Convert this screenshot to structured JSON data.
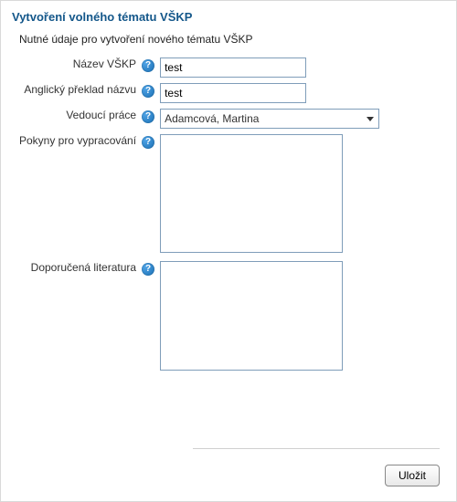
{
  "title": "Vytvoření volného tématu VŠKP",
  "subtitle": "Nutné údaje pro vytvoření nového tématu VŠKP",
  "labels": {
    "name": "Název VŠKP",
    "name_en": "Anglický překlad názvu",
    "supervisor": "Vedoucí práce",
    "instructions": "Pokyny pro vypracování",
    "literature": "Doporučená literatura"
  },
  "values": {
    "name": "test",
    "name_en": "test",
    "supervisor": "Adamcová, Martina",
    "instructions": "",
    "literature": ""
  },
  "buttons": {
    "save": "Uložit"
  },
  "help_glyph": "?"
}
